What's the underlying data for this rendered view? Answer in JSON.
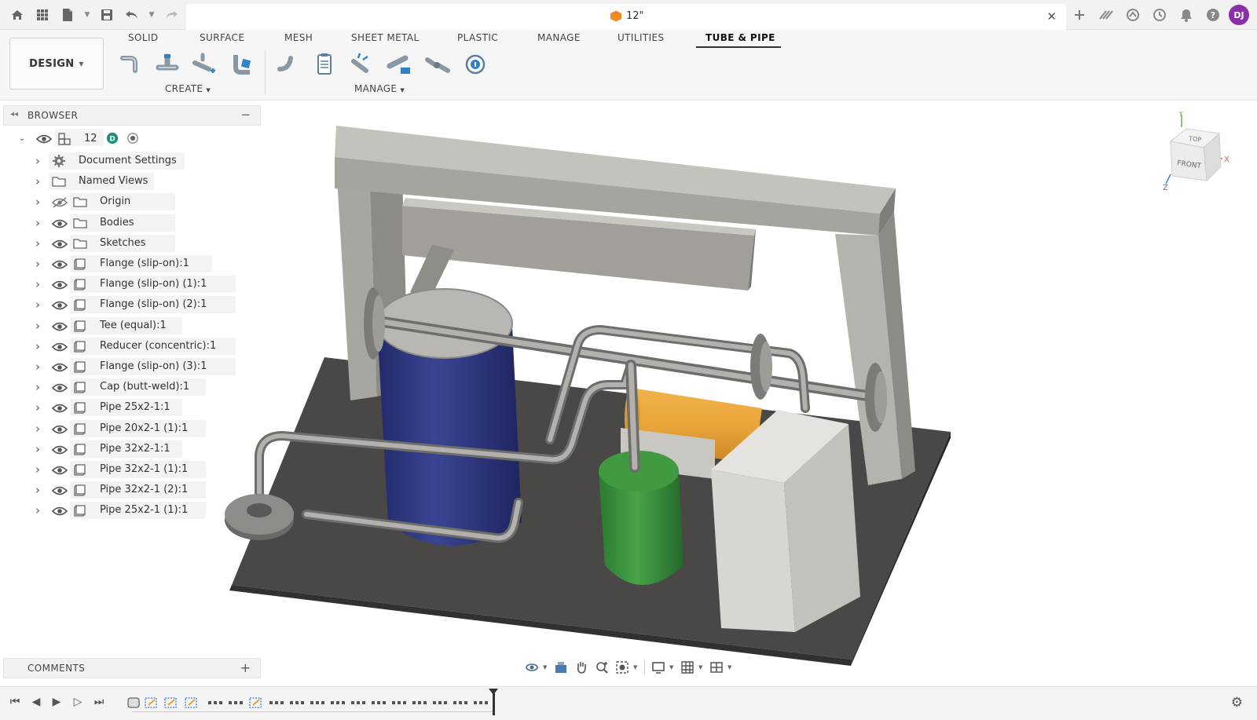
{
  "app": {
    "document_title": "12\"",
    "user_initials": "DJ",
    "accent_color": "#8b2fa8"
  },
  "ribbon": {
    "workspace_label": "DESIGN",
    "tabs": [
      {
        "label": "SOLID",
        "active": false
      },
      {
        "label": "SURFACE",
        "active": false
      },
      {
        "label": "MESH",
        "active": false
      },
      {
        "label": "SHEET METAL",
        "active": false
      },
      {
        "label": "PLASTIC",
        "active": false
      },
      {
        "label": "MANAGE",
        "active": false
      },
      {
        "label": "UTILITIES",
        "active": false
      },
      {
        "label": "TUBE & PIPE",
        "active": true
      }
    ],
    "groups": {
      "create": "CREATE",
      "manage": "MANAGE"
    },
    "create_tools": [
      "pipe-icon",
      "tee-pipe-icon",
      "branch-pipe-icon",
      "route-pipe-icon"
    ],
    "manage_tools": [
      "elbow-icon",
      "bom-icon",
      "connect-icon",
      "pipe-catalog-icon",
      "pipe-assembly-icon",
      "info-icon"
    ]
  },
  "browser": {
    "title": "BROWSER",
    "root": {
      "label": "12"
    },
    "items": [
      {
        "label": "Document Settings",
        "icon": "gear-icon",
        "eye": false
      },
      {
        "label": "Named Views",
        "icon": "folder-icon",
        "eye": false
      },
      {
        "label": "Origin",
        "icon": "folder-icon",
        "eye": "hidden"
      },
      {
        "label": "Bodies",
        "icon": "folder-icon",
        "eye": true
      },
      {
        "label": "Sketches",
        "icon": "folder-icon",
        "eye": true
      },
      {
        "label": "Flange (slip-on):1",
        "icon": "component-icon",
        "eye": true
      },
      {
        "label": "Flange (slip-on) (1):1",
        "icon": "component-icon",
        "eye": true
      },
      {
        "label": "Flange (slip-on) (2):1",
        "icon": "component-icon",
        "eye": true
      },
      {
        "label": "Tee (equal):1",
        "icon": "component-icon",
        "eye": true
      },
      {
        "label": "Reducer (concentric):1",
        "icon": "component-icon",
        "eye": true
      },
      {
        "label": "Flange (slip-on) (3):1",
        "icon": "component-icon",
        "eye": true
      },
      {
        "label": "Cap (butt-weld):1",
        "icon": "component-icon",
        "eye": true
      },
      {
        "label": "Pipe 25x2-1:1",
        "icon": "component-icon",
        "eye": true
      },
      {
        "label": "Pipe 20x2-1 (1):1",
        "icon": "component-icon",
        "eye": true
      },
      {
        "label": "Pipe 32x2-1:1",
        "icon": "component-icon",
        "eye": true
      },
      {
        "label": "Pipe 32x2-1 (1):1",
        "icon": "component-icon",
        "eye": true
      },
      {
        "label": "Pipe 32x2-1 (2):1",
        "icon": "component-icon",
        "eye": true
      },
      {
        "label": "Pipe 25x2-1 (1):1",
        "icon": "component-icon",
        "eye": true
      }
    ]
  },
  "comments": {
    "title": "COMMENTS"
  },
  "viewcube": {
    "top": "TOP",
    "front": "FRONT",
    "axis_x": "X",
    "axis_y": "Y",
    "axis_z": "Z"
  },
  "navbar": {
    "tools": [
      "orbit-icon",
      "look-at-icon",
      "pan-icon",
      "zoom-icon",
      "fit-icon",
      "display-settings-icon",
      "grid-icon",
      "viewports-icon"
    ]
  },
  "timeline": {
    "controls": [
      "go-to-start-icon",
      "step-back-icon",
      "play-icon",
      "step-forward-icon",
      "go-to-end-icon"
    ]
  }
}
